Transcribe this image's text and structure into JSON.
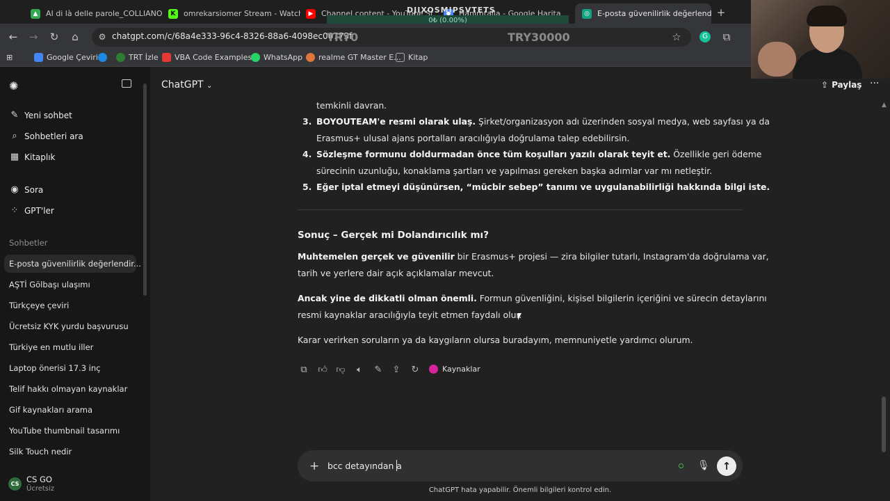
{
  "browser": {
    "tabs": [
      {
        "label": "AI di là delle parole_COLLIANO",
        "color": "#34a853"
      },
      {
        "label": "omrekarsiomer Stream - Watch",
        "color": "#53fc18"
      },
      {
        "label": "Channel content - YouTube St",
        "color": "#ff0000"
      },
      {
        "label": "Hanimtalla - Google Harita",
        "color": "#4285f4"
      },
      {
        "label": "E-posta güvenilirlik değerlendir",
        "color": "#10a37f"
      }
    ],
    "tab_close": "✕",
    "new_tab": "+",
    "overlay_top": "DJIXOSMIPSVTETS",
    "overlay_bar": "0₺ (0.00%)",
    "url": "chatgpt.com/c/68a4e333-96c4-8326-88a6-4098ec00773f",
    "ticker_left": "TRY0",
    "ticker_right": "TRY30000",
    "bookmarks": [
      {
        "label": "Google Çeviri",
        "color": "#4285f4"
      },
      {
        "label": "",
        "color": "#1e88e5"
      },
      {
        "label": "TRT İzle",
        "color": "#2e7d32"
      },
      {
        "label": "VBA Code Examples...",
        "color": "#e53935"
      },
      {
        "label": "WhatsApp",
        "color": "#25d366"
      },
      {
        "label": "realme GT Master E...",
        "color": "#e0743a"
      },
      {
        "label": "Kitap",
        "color": "#aaaaaa"
      }
    ]
  },
  "sidebar": {
    "menu": [
      {
        "label": "Yeni sohbet",
        "icon": "✎"
      },
      {
        "label": "Sohbetleri ara",
        "icon": "⌕"
      },
      {
        "label": "Kitaplık",
        "icon": "▦"
      },
      {
        "label": "Sora",
        "icon": "◉"
      },
      {
        "label": "GPT'ler",
        "icon": "⁘"
      }
    ],
    "section": "Sohbetler",
    "chats": [
      "E-posta güvenilirlik değerlendir...",
      "AŞTİ Gölbaşı ulaşımı",
      "Türkçeye çeviri",
      "Ücretsiz KYK yurdu başvurusu",
      "Türkiye en mutlu iller",
      "Laptop önerisi 17.3 inç",
      "Telif hakkı olmayan kaynaklar",
      "Gif kaynakları arama",
      "YouTube thumbnail tasarımı",
      "Silk Touch nedir"
    ],
    "user": {
      "initials": "CS",
      "name": "CS GO",
      "plan": "Ücretsiz"
    }
  },
  "main": {
    "model": "ChatGPT",
    "share": "Paylaş",
    "more": "···",
    "line_top": "temkinli davran.",
    "list": [
      {
        "n": "3.",
        "bold": "BOYOUTEAM'e resmi olarak ulaş.",
        "rest": " Şirket/organizasyon adı üzerinden sosyal medya, web sayfası ya da",
        "cont": "Erasmus+ ulusal ajans portalları aracılığıyla doğrulama talep edebilirsin."
      },
      {
        "n": "4.",
        "bold": "Sözleşme formunu doldurmadan önce tüm koşulları yazılı olarak teyit et.",
        "rest": " Özellikle geri ödeme",
        "cont": "sürecinin uzunluğu, konaklama şartları ve yapılması gereken başka adımlar var mı netleştir."
      },
      {
        "n": "5.",
        "bold": "Eğer iptal etmeyi düşünürsen, “mücbir sebep” tanımı ve uygulanabilirliği hakkında bilgi iste.",
        "rest": "",
        "cont": ""
      }
    ],
    "heading": "Sonuç – Gerçek mi Dolandırıcılık mı?",
    "p1_bold": "Muhtemelen gerçek ve güvenilir",
    "p1_rest": " bir Erasmus+ projesi — zira bilgiler tutarlı, Instagram'da doğrulama var,",
    "p1_cont": "tarih ve yerlere dair açık açıklamalar mevcut.",
    "p2_bold": "Ancak yine de dikkatli olman önemli.",
    "p2_rest": " Formun güvenliğini, kişisel bilgilerin içeriğini ve sürecin detaylarını",
    "p2_cont": "resmi kaynaklar aracılığıyla teyit etmen faydalı olur.",
    "p3": "Karar verirken soruların ya da kaygıların olursa buradayım, memnuniyetle yardımcı olurum.",
    "sources": "Kaynaklar",
    "composer_text": "bcc detayından a",
    "footer": "ChatGPT hata yapabilir. Önemli bilgileri kontrol edin."
  }
}
